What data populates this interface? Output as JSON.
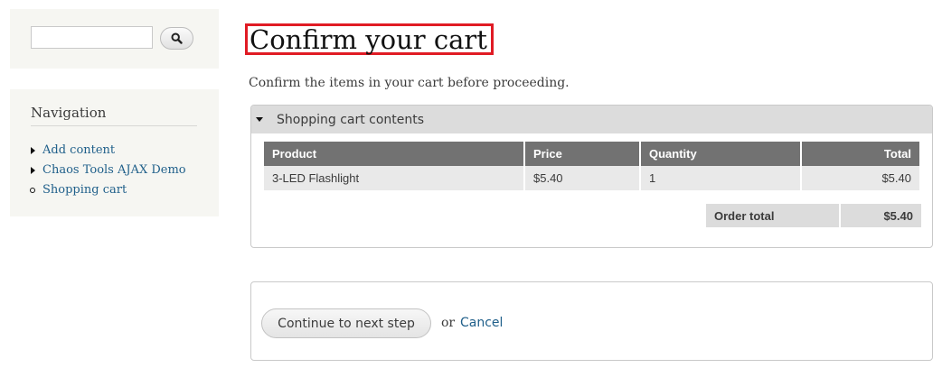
{
  "sidebar": {
    "search": {
      "value": "",
      "button_icon": "search-icon"
    },
    "navigation": {
      "title": "Navigation",
      "items": [
        {
          "label": "Add content",
          "bullet": "collapsed-triangle"
        },
        {
          "label": "Chaos Tools AJAX Demo",
          "bullet": "collapsed-triangle"
        },
        {
          "label": "Shopping cart",
          "bullet": "circle"
        }
      ]
    }
  },
  "main": {
    "title": "Confirm your cart",
    "intro": "Confirm the items in your cart before proceeding.",
    "cart_fieldset": {
      "legend": "Shopping cart contents",
      "headers": [
        "Product",
        "Price",
        "Quantity",
        "Total"
      ],
      "rows": [
        [
          "3-LED Flashlight",
          "$5.40",
          "1",
          "$5.40"
        ]
      ],
      "order_total_label": "Order total",
      "order_total_value": "$5.40"
    },
    "actions": {
      "continue_label": "Continue to next step",
      "or_text": "or",
      "cancel_label": "Cancel"
    }
  },
  "colors": {
    "title_highlight_border": "#e01b24",
    "link": "#1f5f8a",
    "table_header": "#727272"
  }
}
